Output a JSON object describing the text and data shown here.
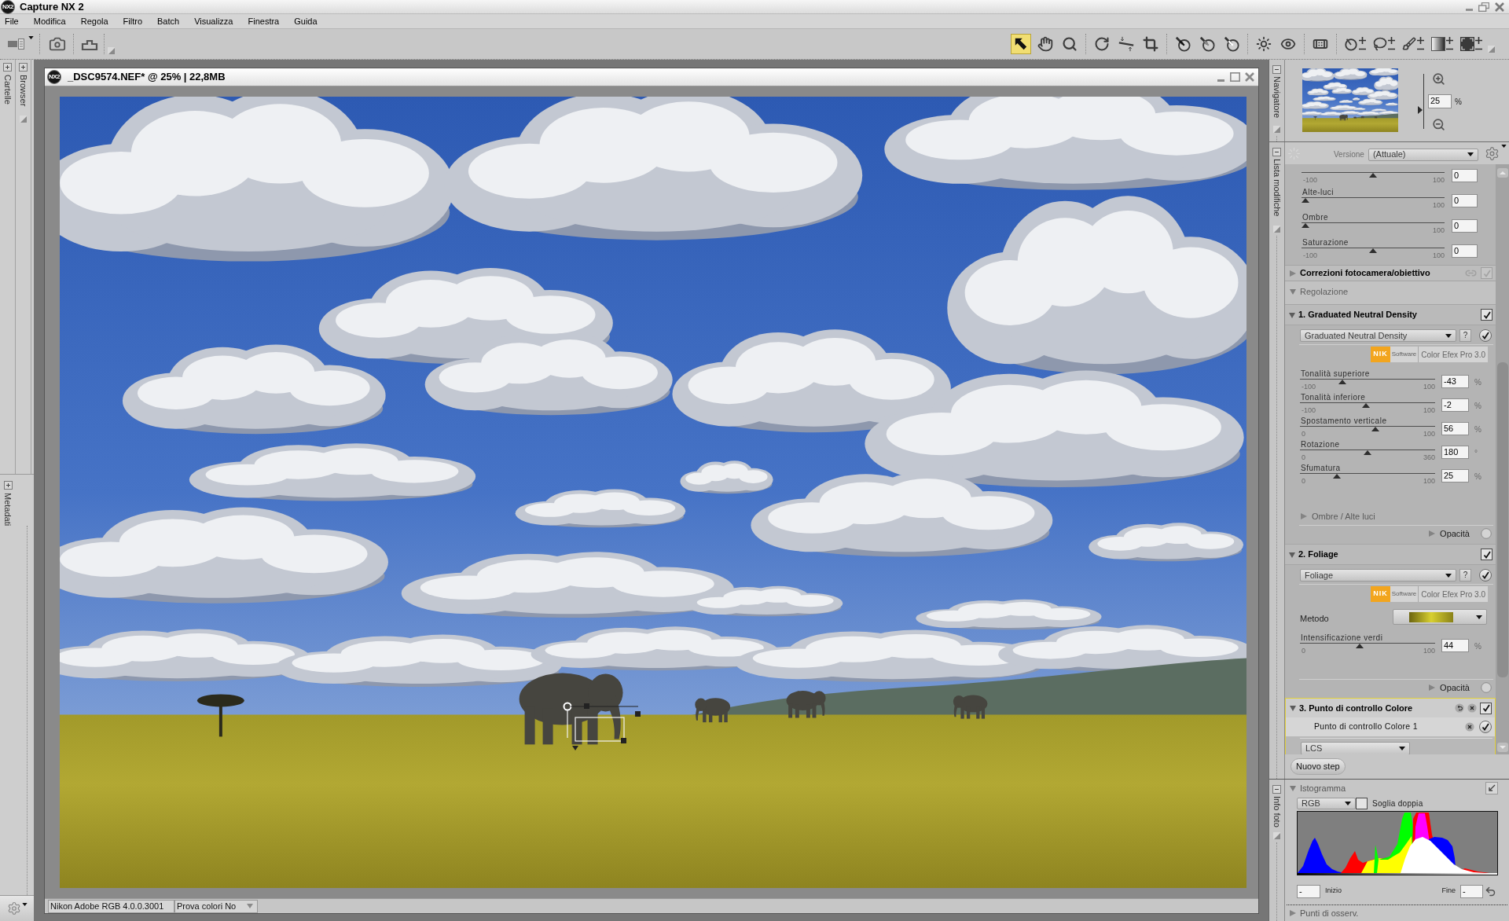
{
  "window": {
    "logo": "NX2",
    "title": "Capture NX 2"
  },
  "menu": [
    "File",
    "Modifica",
    "Regola",
    "Filtro",
    "Batch",
    "Visualizza",
    "Finestra",
    "Guida"
  ],
  "toolbar": {
    "tools": [
      {
        "selected": true
      },
      {
        "selected": false
      },
      {
        "selected": false
      },
      {
        "selected": false
      },
      {
        "selected": false
      },
      {
        "selected": false
      },
      {
        "selected": false
      },
      {
        "selected": false
      },
      {
        "selected": false
      },
      {
        "selected": false
      },
      {
        "selected": false
      },
      {
        "selected": false
      },
      {
        "selected": false
      },
      {
        "selected": false
      },
      {
        "selected": false
      },
      {
        "selected": false
      },
      {
        "selected": false
      }
    ]
  },
  "left_sidebar": {
    "tabs": [
      "Cartelle",
      "Browser"
    ],
    "lower_tab": "Metadati"
  },
  "document": {
    "logo": "NX2",
    "title": "_DSC9574.NEF* @ 25% | 22,8MB",
    "status_bar": {
      "profile": "Nikon Adobe RGB 4.0.0.3001",
      "soft_proof": "Prova colori No"
    }
  },
  "navigator": {
    "tab": "Navigatore",
    "level": 0.31,
    "zoom": "25",
    "unit": "%"
  },
  "edit_list": {
    "tab": "Lista modifiche",
    "version_label": "Versione",
    "version": "(Attuale)",
    "base_sliders": [
      {
        "min": "-100",
        "max": "100",
        "value": "0",
        "level": 0.5
      },
      {
        "label": "Alte-luci",
        "max": "100",
        "value": "0",
        "level": 0
      },
      {
        "label": "Ombre",
        "max": "100",
        "value": "0",
        "level": 0
      },
      {
        "label": "Saturazione",
        "min": "-100",
        "max": "100",
        "value": "0",
        "level": 0.5
      }
    ],
    "camera_corrections": {
      "title": "Correzioni fotocamera/obiettivo",
      "expanded": false,
      "checked": true,
      "disabled": true
    },
    "group": {
      "title": "Regolazione",
      "expanded": true
    },
    "steps": [
      {
        "kind": "filter",
        "title": "1. Graduated Neutral Density",
        "expanded": true,
        "checked": true,
        "selected": false,
        "filter": "Graduated Neutral Density",
        "help": "?",
        "enabled": true,
        "badge": {
          "brand": "NIK",
          "brand_sub": "Software",
          "product": "Color Efex Pro 3.0"
        },
        "controls": [
          {
            "kind": "slider",
            "label": "Tonalità superiore",
            "min": "-100",
            "max": "100",
            "value": "-43",
            "unit": "%",
            "level": 0.3
          },
          {
            "kind": "slider",
            "label": "Tonalità inferiore",
            "min": "-100",
            "max": "100",
            "value": "-2",
            "unit": "%",
            "level": 0.49
          },
          {
            "kind": "slider",
            "label": "Spostamento verticale",
            "min": "0",
            "max": "100",
            "value": "56",
            "unit": "%",
            "level": 0.56
          },
          {
            "kind": "slider",
            "label": "Rotazione",
            "min": "0",
            "max": "360",
            "value": "180",
            "unit": "°",
            "level": 0.5
          },
          {
            "kind": "slider",
            "label": "Sfumatura",
            "min": "0",
            "max": "100",
            "value": "25",
            "unit": "%",
            "level": 0.26
          }
        ],
        "subsection": {
          "title": "Ombre / Alte luci",
          "expanded": false
        },
        "opacity": {
          "label": "Opacità",
          "expanded": false
        }
      },
      {
        "kind": "filter",
        "title": "2. Foliage",
        "expanded": true,
        "checked": true,
        "selected": false,
        "filter": "Foliage",
        "help": "?",
        "enabled": true,
        "badge": {
          "brand": "NIK",
          "brand_sub": "Software",
          "product": "Color Efex Pro 3.0"
        },
        "controls": [
          {
            "kind": "method",
            "label": "Metodo"
          },
          {
            "kind": "slider",
            "label": "Intensificazione verdi",
            "min": "0",
            "max": "100",
            "value": "44",
            "unit": "%",
            "level": 0.44
          }
        ],
        "opacity": {
          "label": "Opacità",
          "expanded": false
        }
      },
      {
        "kind": "control_point",
        "title": "3. Punto di controllo Colore",
        "expanded": true,
        "checked": true,
        "selected": true,
        "points": [
          {
            "label": "Punto di controllo Colore 1",
            "checked": true
          }
        ],
        "mode": "LCS"
      }
    ],
    "new_step": "Nuovo step"
  },
  "photo_info": {
    "tab": "Info foto",
    "histogram": {
      "title": "Istogramma",
      "expanded": true,
      "channel": "RGB",
      "dual_threshold": {
        "label": "Soglia doppia",
        "checked": false
      },
      "start": {
        "label": "Inizio",
        "value": "-"
      },
      "end": {
        "label": "Fine",
        "value": "-"
      }
    },
    "watch_points": {
      "title": "Punti di osserv.",
      "expanded": false
    }
  }
}
